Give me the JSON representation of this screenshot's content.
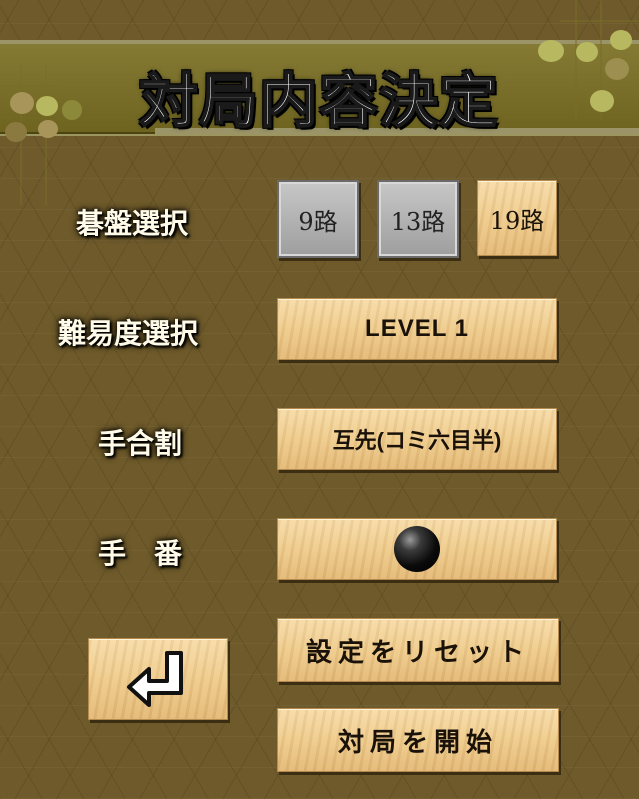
{
  "title": "対局内容決定",
  "labels": {
    "board_size": "碁盤選択",
    "difficulty": "難易度選択",
    "handicap": "手合割",
    "turn": "手　番"
  },
  "board_size_options": [
    "9路",
    "13路",
    "19路"
  ],
  "board_size_selected": "19路",
  "difficulty_value": "LEVEL 1",
  "handicap_value": "互先(コミ六目半)",
  "turn_value_icon": "black-stone-icon",
  "buttons": {
    "reset": "設定をリセット",
    "start": "対局を開始",
    "back_icon": "return-arrow-icon"
  },
  "colors": {
    "background": "#6e5a2a",
    "header": "#857a34",
    "wood": "#eecb8c",
    "disabled": "#9e9e9e"
  }
}
